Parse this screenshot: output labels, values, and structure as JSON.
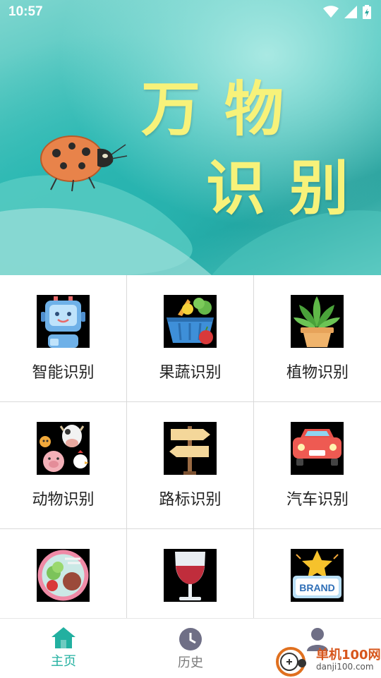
{
  "status_bar": {
    "time": "10:57"
  },
  "hero": {
    "title_line1": "万物",
    "title_line2": "识别"
  },
  "grid": {
    "items": [
      {
        "label": "智能识别",
        "icon": "ai-robot-icon"
      },
      {
        "label": "果蔬识别",
        "icon": "vegetable-basket-icon"
      },
      {
        "label": "植物识别",
        "icon": "potted-plant-icon"
      },
      {
        "label": "动物识别",
        "icon": "farm-animals-icon"
      },
      {
        "label": "路标识别",
        "icon": "signpost-icon"
      },
      {
        "label": "汽车识别",
        "icon": "car-icon"
      },
      {
        "label": "",
        "icon": "food-plate-icon"
      },
      {
        "label": "",
        "icon": "wine-glass-icon"
      },
      {
        "label": "",
        "icon": "brand-badge-icon",
        "badge_text": "BRAND"
      }
    ]
  },
  "bottom_nav": {
    "items": [
      {
        "label": "主页",
        "icon": "home-icon",
        "active": true
      },
      {
        "label": "历史",
        "icon": "clock-icon",
        "active": false
      },
      {
        "label": "",
        "icon": "user-icon",
        "active": false
      }
    ]
  },
  "watermark": {
    "text": "单机100网",
    "url": "danji100.com"
  },
  "colors": {
    "accent": "#22b0a0",
    "hero_text": "#f7f27a",
    "inactive": "#7a7a7a"
  }
}
